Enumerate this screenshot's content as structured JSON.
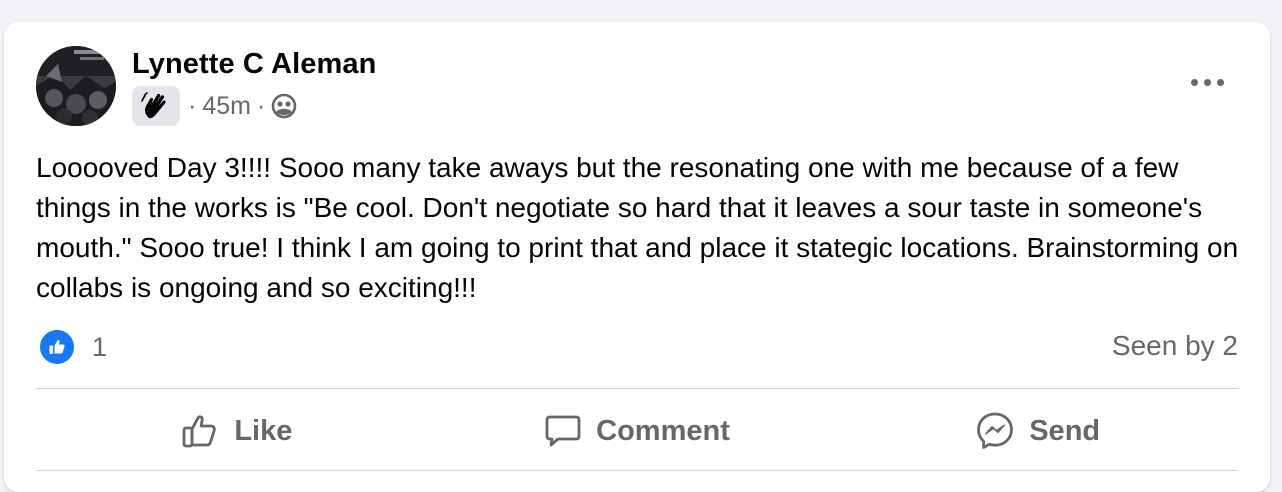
{
  "post": {
    "author": "Lynette C Aleman",
    "avatar_icon": "profile-photo",
    "badge_icon": "waving-hand-icon",
    "separator": "·",
    "time": "45m",
    "audience_icon": "group-audience-icon",
    "more_icon": "more-options-icon",
    "text": "Looooved Day 3!!!! Sooo many take aways but the resonating one with me because of a few things in the works is \"Be cool. Don't negotiate so hard that it leaves a sour taste in someone's mouth.\" Sooo true! I think I am going to print that and place it stategic locations. Brainstorming on collabs is ongoing and so exciting!!!"
  },
  "reactions": {
    "icon": "like-reaction-icon",
    "count": "1",
    "seen_by": "Seen by 2"
  },
  "actions": {
    "like_label": "Like",
    "comment_label": "Comment",
    "send_label": "Send"
  },
  "colors": {
    "background": "#f0f2f5",
    "card": "#ffffff",
    "secondary_text": "#65676b",
    "accent": "#1877f2",
    "divider": "#ced0d4"
  }
}
